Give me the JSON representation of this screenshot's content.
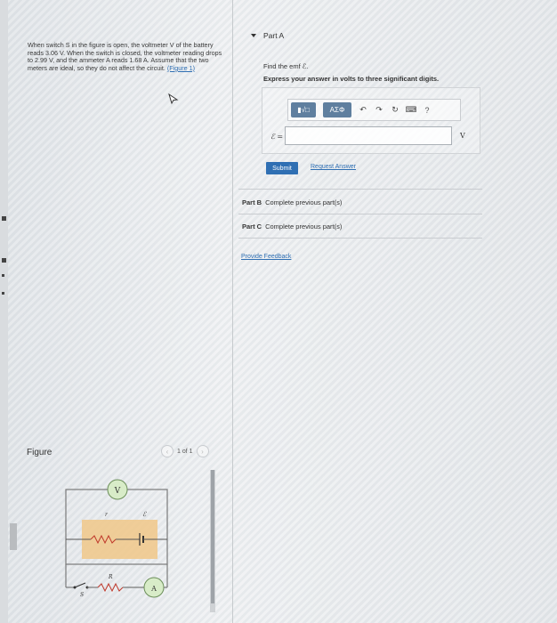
{
  "problem": {
    "text_before_link": "When switch S in the figure is open, the voltmeter V of the battery reads 3.06 V. When the switch is closed, the voltmeter reading drops to 2.99 V, and the ammeter A reads 1.68 A. Assume that the two meters are ideal, so they do not affect the circuit.",
    "figure_link": "(Figure 1)"
  },
  "figure": {
    "title": "Figure",
    "pager": "1 of 1",
    "prev_icon": "chevron-left-icon",
    "next_icon": "chevron-right-icon",
    "circuit_labels": {
      "voltmeter": "V",
      "r": "r",
      "emf": "ℰ",
      "R": "R",
      "ammeter": "A",
      "switch": "S"
    }
  },
  "part_a": {
    "header": "Part A",
    "prompt": "Find the emf ℰ.",
    "instruction": "Express your answer in volts to three significant digits.",
    "toolbar": {
      "matrix_label": "▮√□",
      "greek_label": "ΑΣΦ",
      "undo_icon": "↶",
      "redo_icon": "↷",
      "reset_icon": "↻",
      "keyboard_icon": "⌨",
      "help_icon": "?"
    },
    "variable_label": "ℰ =",
    "input_value": "",
    "unit": "V",
    "submit_label": "Submit",
    "request_label": "Request Answer"
  },
  "part_b": {
    "label": "Part B",
    "status": "Complete previous part(s)"
  },
  "part_c": {
    "label": "Part C",
    "status": "Complete previous part(s)"
  },
  "feedback_label": "Provide Feedback",
  "colors": {
    "accent": "#2f6fb3",
    "toolbar_button": "#5f7f9f"
  }
}
